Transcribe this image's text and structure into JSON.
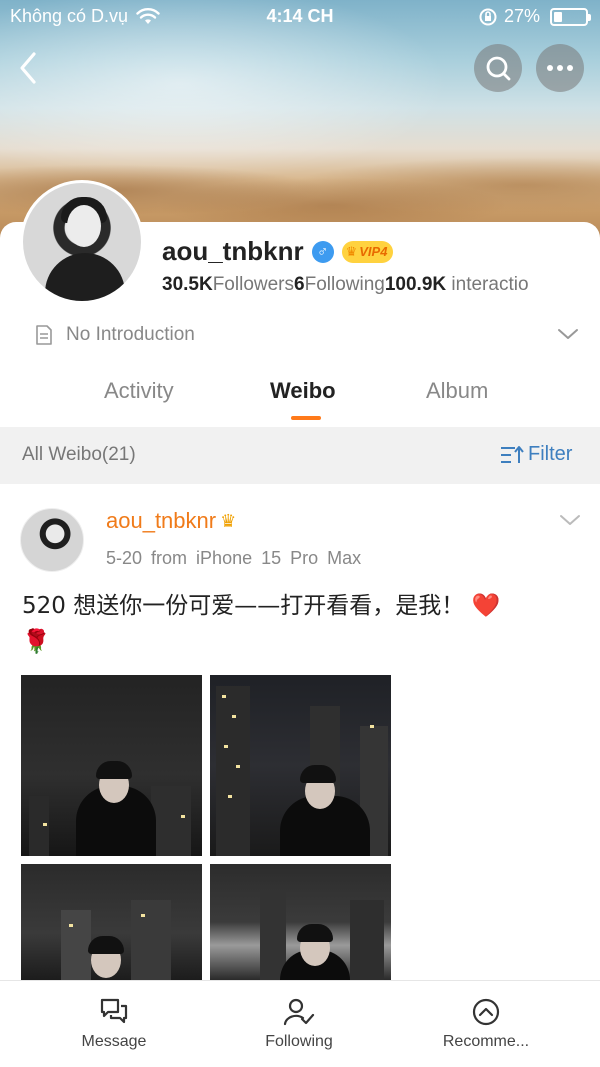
{
  "status_bar": {
    "carrier": "Không có D.vụ",
    "time": "4:14 CH",
    "battery": "27%",
    "battery_level": 0.27
  },
  "profile": {
    "username": "aou_tnbknr",
    "gender_icon": "male-icon",
    "vip": "VIP4",
    "followers_count": "30.5K",
    "followers_label": "Followers",
    "following_count": "6",
    "following_label": "Following",
    "interactions_count": "100.9K",
    "interactions_label": "interactio",
    "intro": "No Introduction"
  },
  "tabs": [
    {
      "label": "Activity",
      "active": false
    },
    {
      "label": "Weibo",
      "active": true
    },
    {
      "label": "Album",
      "active": false
    }
  ],
  "filter_bar": {
    "all_label": "All Weibo(21)",
    "filter_label": "Filter"
  },
  "post": {
    "author": "aou_tnbknr",
    "date": "5-20",
    "source": "from iPhone 15 Pro Max",
    "text": "520 想送你一份可爱——打开看看，是我！",
    "emoji_heart": "❤️",
    "emoji_rose": "🌹"
  },
  "bottom_bar": [
    {
      "label": "Message",
      "icon": "message-icon"
    },
    {
      "label": "Following",
      "icon": "following-icon"
    },
    {
      "label": "Recomme...",
      "icon": "recommend-icon"
    }
  ],
  "colors": {
    "accent": "#ff7a1a",
    "username_orange": "#f07b1a",
    "link_blue": "#3e7fbf"
  }
}
